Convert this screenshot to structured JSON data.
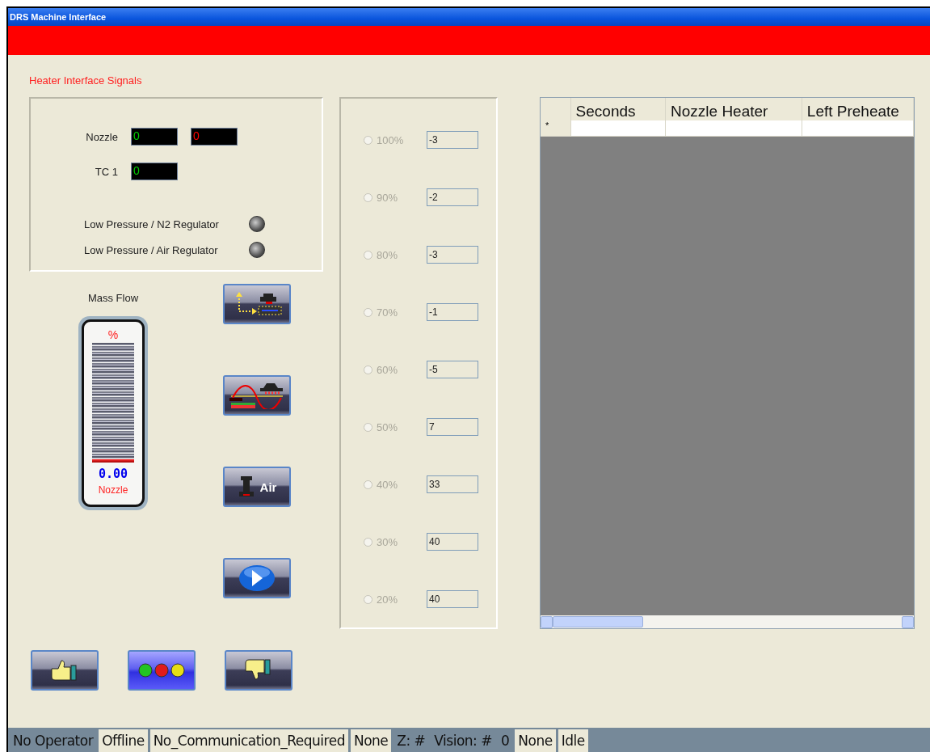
{
  "window": {
    "title": "DRS Machine Interface"
  },
  "heading": "Heater Interface Signals",
  "signals": {
    "readouts": [
      {
        "label": "Nozzle",
        "values": [
          {
            "text": "0",
            "color": "#00cc00"
          },
          {
            "text": "0",
            "color": "#ff0000"
          }
        ]
      },
      {
        "label": "TC 1",
        "values": [
          {
            "text": "0",
            "color": "#00cc00"
          }
        ]
      }
    ],
    "indicators": [
      {
        "label": "Low Pressure / N2 Regulator",
        "on": false
      },
      {
        "label": "Low Pressure / Air Regulator",
        "on": false
      }
    ]
  },
  "mass_flow": {
    "title": "Mass Flow",
    "unit": "%",
    "level": 0,
    "value": "0.00",
    "caption": "Nozzle"
  },
  "side_buttons": [
    {
      "kind": "motion"
    },
    {
      "kind": "profile"
    },
    {
      "kind": "air",
      "label": "Air"
    },
    {
      "kind": "play"
    }
  ],
  "bottom_buttons": [
    {
      "kind": "accept",
      "active": false
    },
    {
      "kind": "lights",
      "active": true
    },
    {
      "kind": "reject",
      "active": false
    }
  ],
  "power_levels": [
    {
      "label": "100%",
      "selected": false,
      "disabled": true,
      "value": "-3"
    },
    {
      "label": "90%",
      "selected": false,
      "disabled": true,
      "value": "-2"
    },
    {
      "label": "80%",
      "selected": false,
      "disabled": true,
      "value": "-3"
    },
    {
      "label": "70%",
      "selected": false,
      "disabled": true,
      "value": "-1"
    },
    {
      "label": "60%",
      "selected": false,
      "disabled": true,
      "value": "-5"
    },
    {
      "label": "50%",
      "selected": false,
      "disabled": true,
      "value": "7"
    },
    {
      "label": "40%",
      "selected": false,
      "disabled": true,
      "value": "33"
    },
    {
      "label": "30%",
      "selected": false,
      "disabled": true,
      "value": "40"
    },
    {
      "label": "20%",
      "selected": false,
      "disabled": true,
      "value": "40"
    }
  ],
  "table": {
    "columns": [
      "Seconds",
      "Nozzle Heater",
      "Left Preheate"
    ],
    "new_row_marker": "*"
  },
  "status_bar": [
    {
      "text": "No Operator",
      "boxed": false
    },
    {
      "text": "Offline",
      "boxed": true
    },
    {
      "text": "No_Communication_Required",
      "boxed": true
    },
    {
      "text": "None",
      "boxed": true
    },
    {
      "text": "Z: #",
      "boxed": false
    },
    {
      "text": "Vision: #",
      "boxed": false
    },
    {
      "text": "0",
      "boxed": false
    },
    {
      "text": "None",
      "boxed": true
    },
    {
      "text": "Idle",
      "boxed": true
    }
  ]
}
